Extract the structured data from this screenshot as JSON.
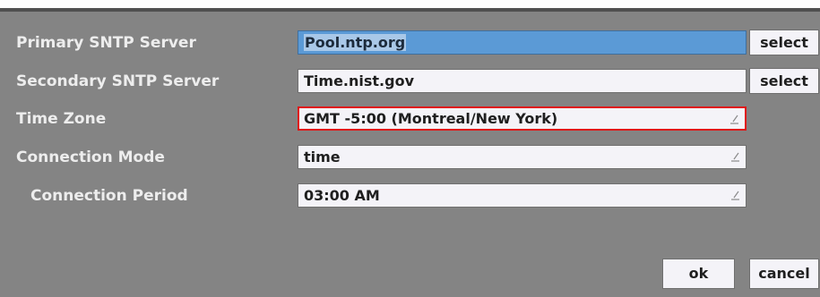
{
  "form": {
    "primary_sntp": {
      "label": "Primary SNTP Server",
      "value": "Pool.ntp.org",
      "select_label": "select"
    },
    "secondary_sntp": {
      "label": "Secondary SNTP Server",
      "value": "Time.nist.gov",
      "select_label": "select"
    },
    "time_zone": {
      "label": "Time Zone",
      "value": "GMT -5:00  (Montreal/New York)"
    },
    "connection_mode": {
      "label": "Connection Mode",
      "value": "time"
    },
    "connection_period": {
      "label": "Connection Period",
      "value": "03:00  AM"
    }
  },
  "buttons": {
    "ok": "ok",
    "cancel": "cancel"
  },
  "colors": {
    "panel": "#848484",
    "field": "#f4f3f8",
    "selected_field": "#5b9ad6",
    "focus_outline": "#e01616"
  }
}
